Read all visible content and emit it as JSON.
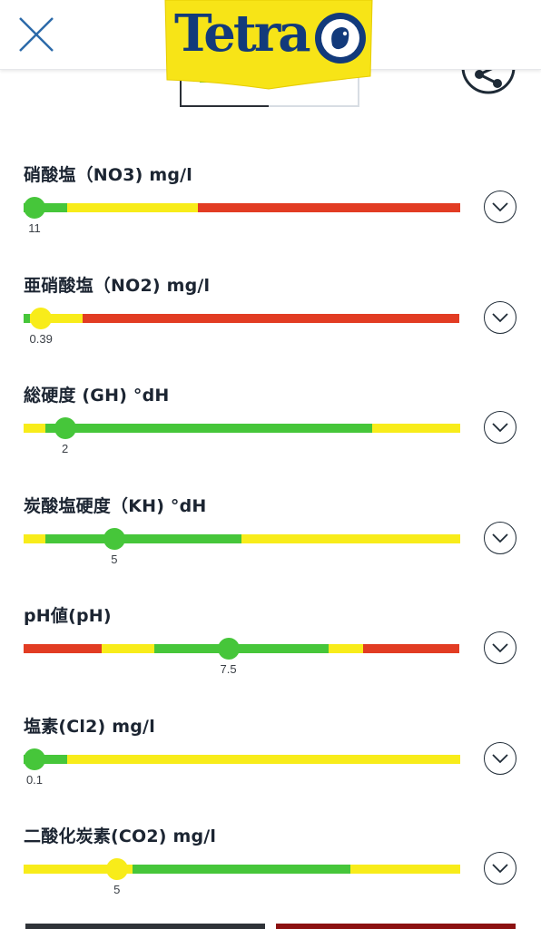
{
  "header": {
    "logo_text": "Tetra",
    "brand_colors": {
      "yellow": "#f7e417",
      "blue": "#123a7b"
    }
  },
  "colors": {
    "green": "#46c63a",
    "yellow": "#f8ec1a",
    "red": "#e23c23"
  },
  "parameters": [
    {
      "label": "硝酸塩（NO3) mg/l",
      "value_label": "11",
      "value_fraction": 0.025,
      "knob_color": "green",
      "segments": [
        {
          "color": "green",
          "from": 0.0,
          "to": 0.1
        },
        {
          "color": "yellow",
          "from": 0.1,
          "to": 0.4
        },
        {
          "color": "red",
          "from": 0.4,
          "to": 1.0
        }
      ]
    },
    {
      "label": "亜硝酸塩（NO2) mg/l",
      "value_label": "0.39",
      "value_fraction": 0.04,
      "knob_color": "yellow",
      "segments": [
        {
          "color": "green",
          "from": 0.0,
          "to": 0.015
        },
        {
          "color": "yellow",
          "from": 0.015,
          "to": 0.135
        },
        {
          "color": "red",
          "from": 0.135,
          "to": 1.0
        }
      ]
    },
    {
      "label": "総硬度 (GH) °dH",
      "value_label": "2",
      "value_fraction": 0.095,
      "knob_color": "green",
      "segments": [
        {
          "color": "yellow",
          "from": 0.0,
          "to": 0.05
        },
        {
          "color": "green",
          "from": 0.05,
          "to": 0.8
        },
        {
          "color": "yellow",
          "from": 0.8,
          "to": 1.0
        }
      ]
    },
    {
      "label": "炭酸塩硬度（KH) °dH",
      "value_label": "5",
      "value_fraction": 0.208,
      "knob_color": "green",
      "segments": [
        {
          "color": "yellow",
          "from": 0.0,
          "to": 0.05
        },
        {
          "color": "green",
          "from": 0.05,
          "to": 0.5
        },
        {
          "color": "yellow",
          "from": 0.5,
          "to": 1.0
        }
      ]
    },
    {
      "label": "pH値(pH)",
      "value_label": "7.5",
      "value_fraction": 0.47,
      "knob_color": "green",
      "segments": [
        {
          "color": "red",
          "from": 0.0,
          "to": 0.18
        },
        {
          "color": "yellow",
          "from": 0.18,
          "to": 0.3
        },
        {
          "color": "green",
          "from": 0.3,
          "to": 0.7
        },
        {
          "color": "yellow",
          "from": 0.7,
          "to": 0.78
        },
        {
          "color": "red",
          "from": 0.78,
          "to": 1.0
        }
      ]
    },
    {
      "label": "塩素(Cl2) mg/l",
      "value_label": "0.1",
      "value_fraction": 0.025,
      "knob_color": "green",
      "segments": [
        {
          "color": "green",
          "from": 0.0,
          "to": 0.1
        },
        {
          "color": "yellow",
          "from": 0.1,
          "to": 1.0
        }
      ]
    },
    {
      "label": "二酸化炭素(CO2) mg/l",
      "value_label": "5",
      "value_fraction": 0.214,
      "knob_color": "yellow",
      "segments": [
        {
          "color": "yellow",
          "from": 0.0,
          "to": 0.25
        },
        {
          "color": "green",
          "from": 0.25,
          "to": 0.75
        },
        {
          "color": "yellow",
          "from": 0.75,
          "to": 1.0
        }
      ]
    }
  ]
}
